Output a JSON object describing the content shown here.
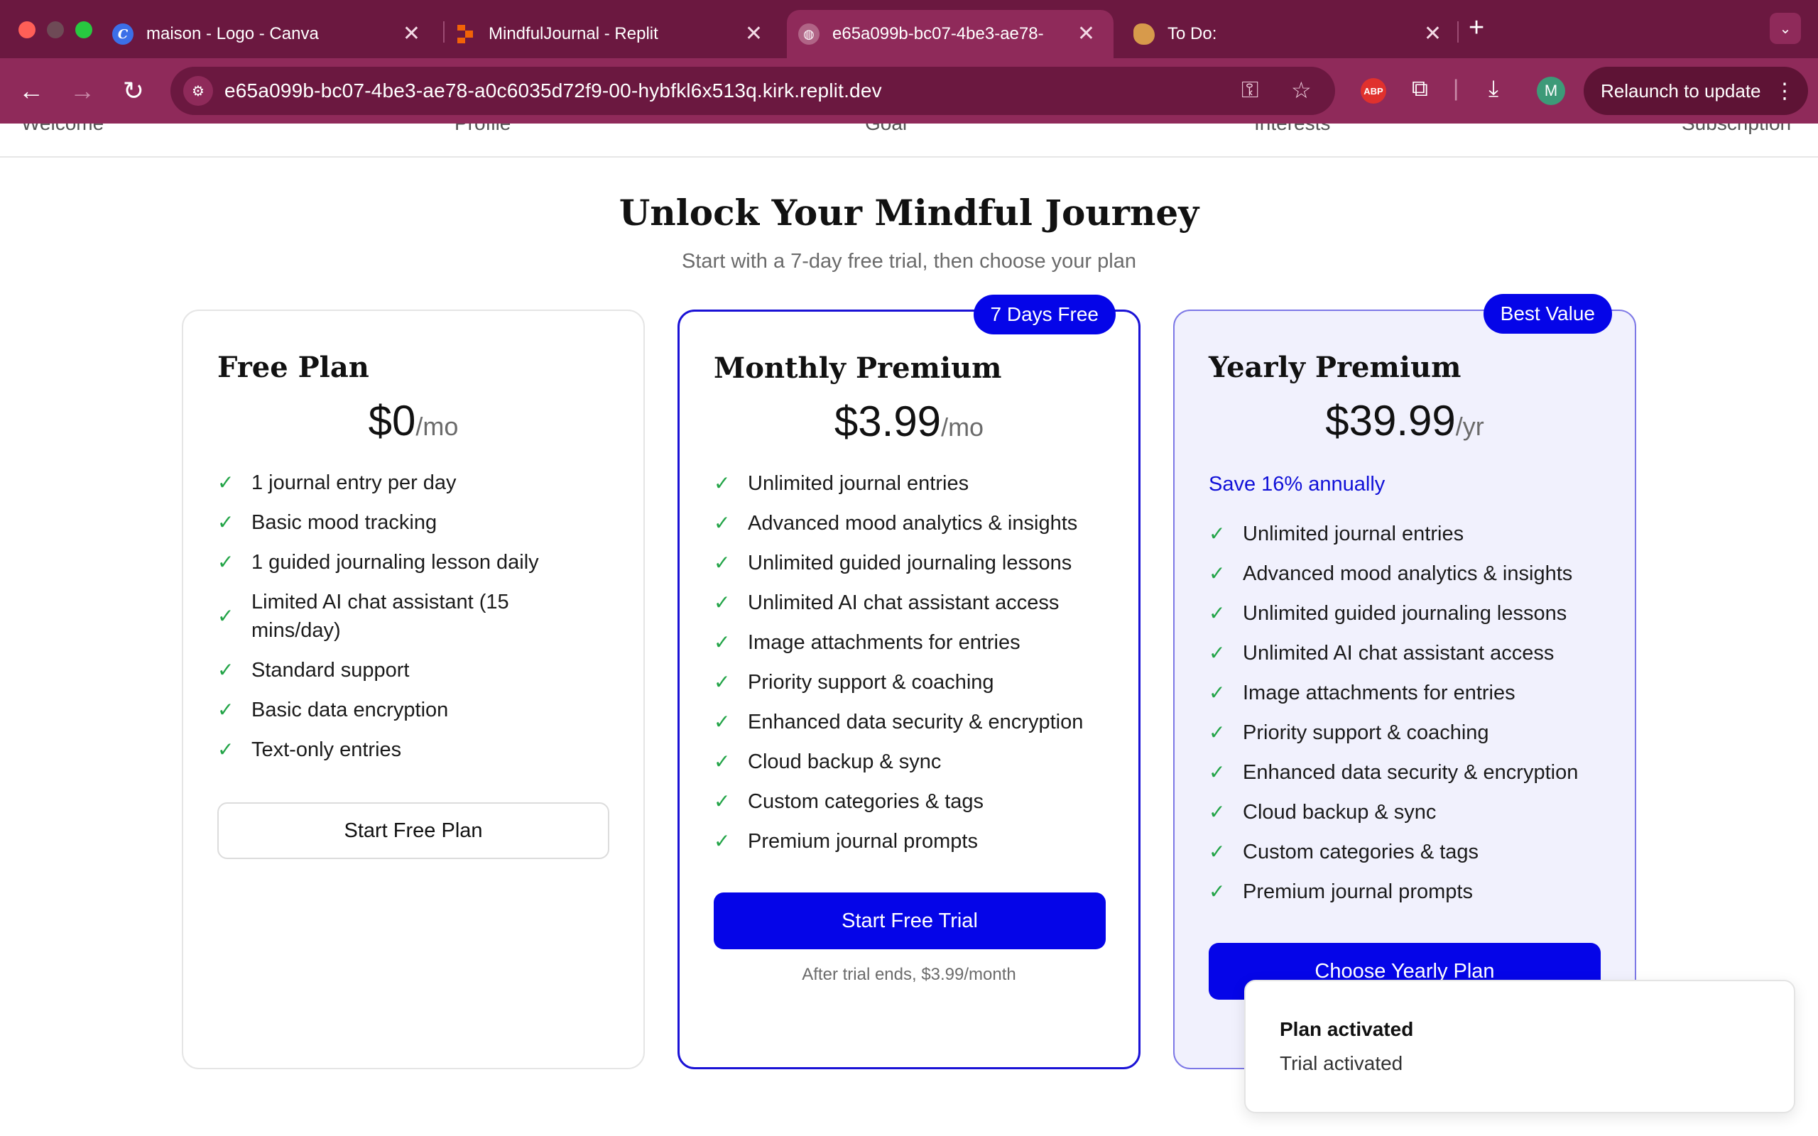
{
  "browser": {
    "tabs": [
      {
        "title": "maison - Logo - Canva",
        "icon": "canva-icon",
        "active": false
      },
      {
        "title": "MindfulJournal - Replit",
        "icon": "replit-icon",
        "active": false
      },
      {
        "title": "e65a099b-bc07-4be3-ae78-",
        "icon": "globe-icon",
        "active": true
      },
      {
        "title": "To Do:",
        "icon": "todo-icon",
        "active": false
      }
    ],
    "url": "e65a099b-bc07-4be3-ae78-a0c6035d72f9-00-hybfkl6x513q.kirk.replit.dev",
    "abp_label": "ABP",
    "avatar_initial": "M",
    "relaunch_label": "Relaunch to update",
    "colors": {
      "tabbar": "#6b1840",
      "toolbar": "#8f2a5a"
    }
  },
  "page_nav": [
    "Welcome",
    "Profile",
    "Goal",
    "Interests",
    "Subscription"
  ],
  "hero": {
    "title": "Unlock Your Mindful Journey",
    "subtitle": "Start with a 7-day free trial, then choose your plan"
  },
  "plans": {
    "free": {
      "name": "Free Plan",
      "price": "$0",
      "period": "/mo",
      "features": [
        "1 journal entry per day",
        "Basic mood tracking",
        "1 guided journaling lesson daily",
        "Limited AI chat assistant (15 mins/day)",
        "Standard support",
        "Basic data encryption",
        "Text-only entries"
      ],
      "button": "Start Free Plan"
    },
    "monthly": {
      "badge": "7 Days Free",
      "name": "Monthly Premium",
      "price": "$3.99",
      "period": "/mo",
      "features": [
        "Unlimited journal entries",
        "Advanced mood analytics & insights",
        "Unlimited guided journaling lessons",
        "Unlimited AI chat assistant access",
        "Image attachments for entries",
        "Priority support & coaching",
        "Enhanced data security & encryption",
        "Cloud backup & sync",
        "Custom categories & tags",
        "Premium journal prompts"
      ],
      "button": "Start Free Trial",
      "note": "After trial ends, $3.99/month"
    },
    "yearly": {
      "badge": "Best Value",
      "name": "Yearly Premium",
      "price": "$39.99",
      "period": "/yr",
      "save_note": "Save 16% annually",
      "features": [
        "Unlimited journal entries",
        "Advanced mood analytics & insights",
        "Unlimited guided journaling lessons",
        "Unlimited AI chat assistant access",
        "Image attachments for entries",
        "Priority support & coaching",
        "Enhanced data security & encryption",
        "Cloud backup & sync",
        "Custom categories & tags",
        "Premium journal prompts"
      ],
      "button": "Choose Yearly Plan"
    }
  },
  "toast": {
    "title": "Plan activated",
    "description": "Trial activated"
  },
  "colors": {
    "accent": "#0505e8",
    "check": "#22a447"
  }
}
